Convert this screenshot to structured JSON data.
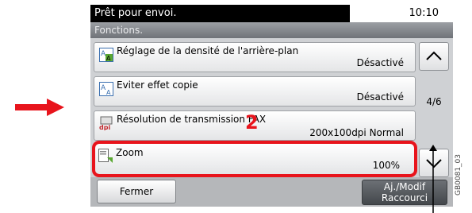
{
  "status": {
    "message": "Prêt pour envoi.",
    "time": "10:10"
  },
  "header": {
    "title": "Fonctions."
  },
  "rows": [
    {
      "label": "Réglage de la densité de l'arrière-plan",
      "value": "Désactivé",
      "icon": "background-density-icon"
    },
    {
      "label": "Eviter effet copie",
      "value": "Désactivé",
      "icon": "prevent-bleed-through-icon"
    },
    {
      "label": "Résolution de transmission FAX",
      "value": "200x100dpi Normal",
      "icon": "fax-resolution-icon"
    },
    {
      "label": "Zoom",
      "value": "100%",
      "icon": "zoom-icon",
      "selected": true
    }
  ],
  "pager": {
    "label": "4/6"
  },
  "footer": {
    "close_label": "Fermer",
    "shortcut_line1": "Aj./Modif",
    "shortcut_line2": "Raccourci"
  },
  "annotations": {
    "step_number": "2",
    "image_code": "GB0081_03"
  },
  "colors": {
    "highlight": "#e8141c",
    "status_bg": "#000000"
  }
}
